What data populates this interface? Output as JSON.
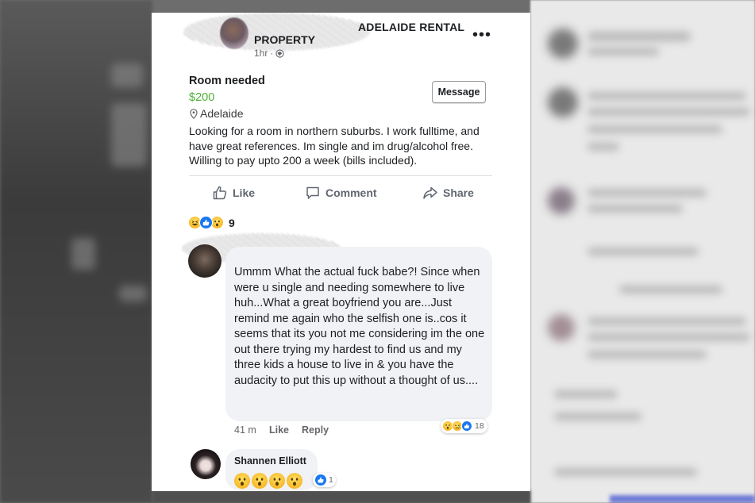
{
  "post": {
    "group_name_line1": "ADELAIDE RENTAL",
    "group_name_line2": "PROPERTY",
    "timestamp": "1hr",
    "separator": "·",
    "more_label": "•••",
    "listing_title": "Room needed",
    "price": "$200",
    "location": "Adelaide",
    "message_button": "Message",
    "description": "Looking for a room in northern suburbs. I work fulltime, and have great references. Im single and im drug/alcohol free. Willing to pay upto 200 a week (bills included).",
    "actions": {
      "like": "Like",
      "comment": "Comment",
      "share": "Share"
    },
    "reaction_count": "9",
    "reaction_types": [
      "haha",
      "like",
      "wow"
    ]
  },
  "comment": {
    "text": "Ummm What the actual fuck babe?! Since when were u single and needing somewhere to live huh...What a great boyfriend you are...Just remind me again who the selfish one is..cos it seems that its you not me considering im the one out there trying my  hardest to find us and my three kids a house to live in & you have the audacity to put this up without a thought of us....",
    "time": "41 m",
    "like_label": "Like",
    "reply_label": "Reply",
    "reaction_count": "18",
    "reaction_types": [
      "wow",
      "sad",
      "like"
    ]
  },
  "reply": {
    "author": "Shannen Elliott",
    "emojis": [
      "wow",
      "wow",
      "wow",
      "wow"
    ],
    "reaction_count": "1",
    "reaction_types": [
      "like"
    ]
  },
  "colors": {
    "price_green": "#4caf34",
    "like_blue": "#1877f2",
    "bubble_grey": "#f0f2f5",
    "reaction_yellow": "#f7b928"
  }
}
